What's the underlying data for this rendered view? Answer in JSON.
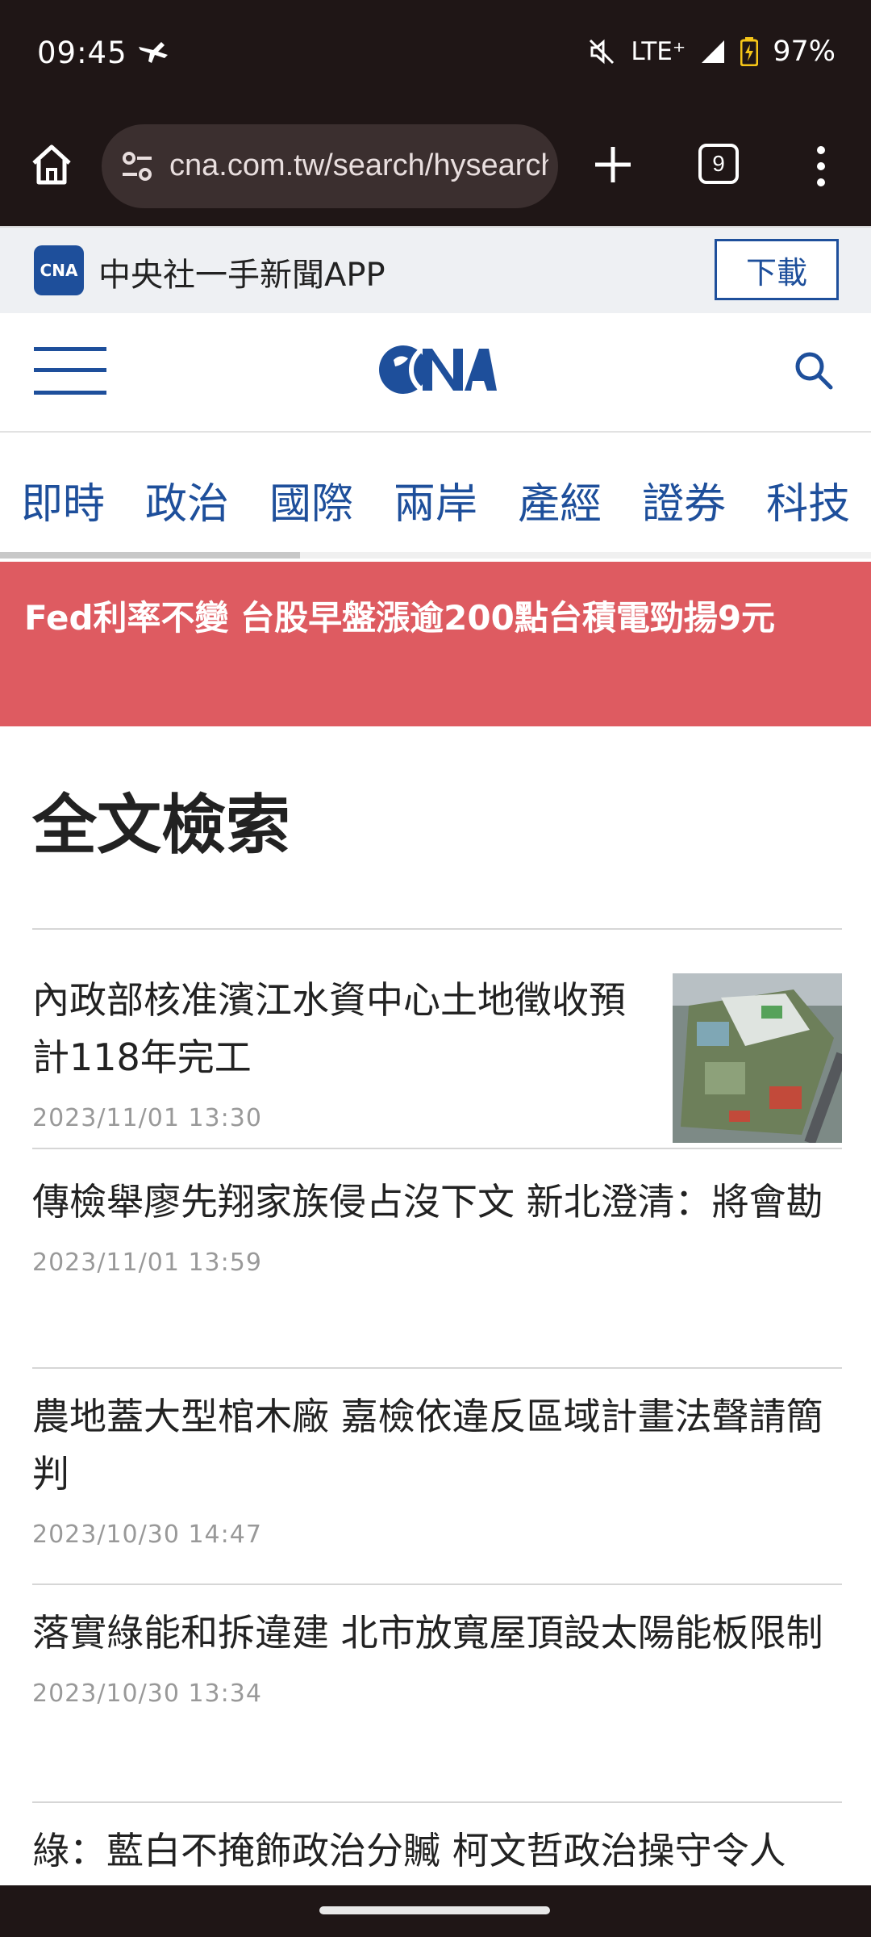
{
  "status_bar": {
    "time": "09:45",
    "network": "LTE⁺",
    "battery": "97%",
    "icons": [
      "bird-icon",
      "mute-icon",
      "signal-icon",
      "battery-icon"
    ]
  },
  "browser": {
    "url": "cna.com.tw/search/hysearchws.aspx?q=",
    "tab_count": "9",
    "icons": [
      "home-icon",
      "site-settings-icon",
      "plus-icon",
      "more-vert-icon"
    ]
  },
  "app_banner": {
    "logo_text": "CNA",
    "title": "中央社一手新聞APP",
    "download_label": "下載"
  },
  "header": {
    "logo_text": "CNA",
    "icons": [
      "hamburger-icon",
      "search-icon"
    ]
  },
  "categories": [
    {
      "label": "即時"
    },
    {
      "label": "政治"
    },
    {
      "label": "國際"
    },
    {
      "label": "兩岸"
    },
    {
      "label": "產經"
    },
    {
      "label": "證券"
    },
    {
      "label": "科技"
    }
  ],
  "breaking": {
    "text": "Fed利率不變 台股早盤漲逾200點台積電勁揚9元"
  },
  "main": {
    "heading": "全文檢索",
    "articles": [
      {
        "title": "內政部核准濱江水資中心土地徵收預計118年完工",
        "date": "2023/11/01 13:30"
      },
      {
        "title": "傳檢舉廖先翔家族侵占沒下文 新北澄清：將會勘",
        "date": "2023/11/01 13:59"
      },
      {
        "title": "農地蓋大型棺木廠 嘉檢依違反區域計畫法聲請簡判",
        "date": "2023/10/30 14:47"
      },
      {
        "title": "落實綠能和拆違建 北市放寬屋頂設太陽能板限制",
        "date": "2023/10/30 13:34"
      },
      {
        "title": "綠：藍白不掩飾政治分贓 柯文哲政治操守令人",
        "date": ""
      }
    ]
  },
  "colors": {
    "brand_blue": "#1e4f9b",
    "breaking_red": "#de5b61",
    "chrome_dark": "#1f1616"
  }
}
